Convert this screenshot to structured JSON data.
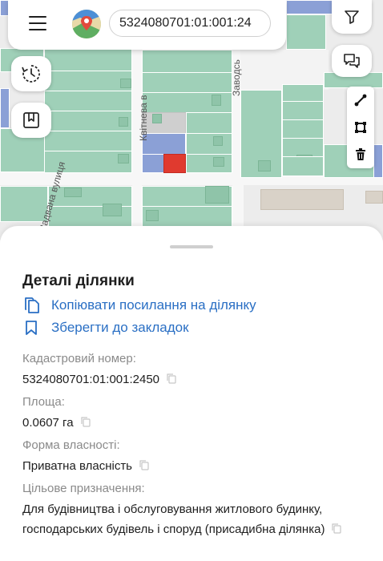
{
  "header": {
    "menu_icon": "hamburger-menu-icon",
    "logo_icon": "map-pin-logo-icon",
    "cadastral_search_value": "5324080701:01:001:24"
  },
  "map": {
    "streets": [
      "Квітнева в",
      "Заводсь",
      "Задвана вулиця"
    ],
    "controls": {
      "filter_icon": "filter-icon",
      "comments_icon": "speech-bubbles-icon",
      "history_icon": "history-clock-icon",
      "bookmark_icon": "bookmark-icon",
      "measure_line_icon": "measure-line-icon",
      "measure_area_icon": "measure-area-icon",
      "clear_icon": "trash-icon"
    },
    "colors": {
      "parcel_green": "#9fd0b8",
      "parcel_blue": "#8ba0d6",
      "selected_parcel": "#e03a2f"
    }
  },
  "details": {
    "title": "Деталі ділянки",
    "copy_link_label": "Копіювати посилання на ділянку",
    "bookmark_label": "Зберегти до закладок",
    "cadastral_label": "Кадастровий номер:",
    "cadastral_value": "5324080701:01:001:2450",
    "area_label": "Площа:",
    "area_value": "0.0607 га",
    "ownership_label": "Форма власності:",
    "ownership_value": "Приватна власність",
    "purpose_label": "Цільове призначення:",
    "purpose_value": "Для будівництва і обслуговування житлового будинку, господарських будівель і споруд (присадибна ділянка)",
    "accent_color": "#2a6fc4"
  }
}
